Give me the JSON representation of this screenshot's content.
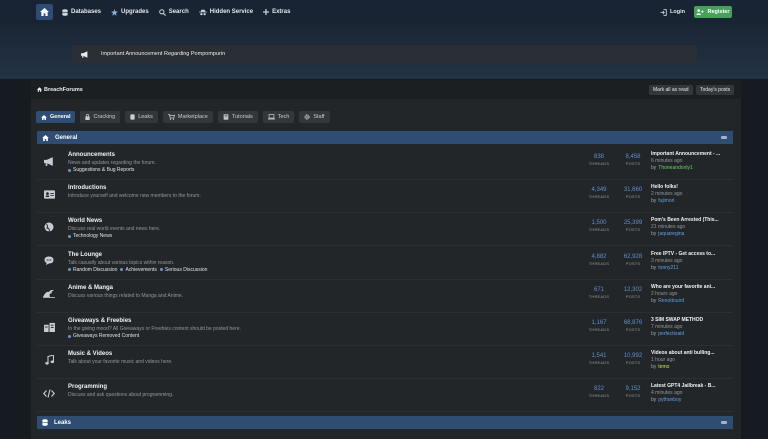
{
  "nav": {
    "items": [
      {
        "label": "Databases",
        "icon": "database-icon"
      },
      {
        "label": "Upgrades",
        "icon": "star-icon"
      },
      {
        "label": "Search",
        "icon": "search-icon"
      },
      {
        "label": "Hidden Service",
        "icon": "incognito-icon"
      },
      {
        "label": "Extras",
        "icon": "plus-icon"
      }
    ],
    "login_label": "Login",
    "register_label": "Register"
  },
  "announcement": {
    "text": "Important Announcement Regarding Pompompurin"
  },
  "breadcrumb": {
    "label": "BreachForums"
  },
  "header_buttons": {
    "mark_read": "Mark all as read",
    "todays_posts": "Today's posts"
  },
  "tabs": [
    {
      "label": "General",
      "icon": "home-icon",
      "active": true
    },
    {
      "label": "Cracking",
      "icon": "lock-icon"
    },
    {
      "label": "Leaks",
      "icon": "database-icon"
    },
    {
      "label": "Marketplace",
      "icon": "cart-icon"
    },
    {
      "label": "Tutorials",
      "icon": "book-icon"
    },
    {
      "label": "Tech",
      "icon": "laptop-icon"
    },
    {
      "label": "Staff",
      "icon": "gear-icon"
    }
  ],
  "categories": {
    "general": {
      "title": "General"
    },
    "leaks": {
      "title": "Leaks"
    }
  },
  "forums": [
    {
      "title": "Announcements",
      "description": "News and updates regarding the forum.",
      "subforums": [
        "Suggestions & Bug Reports"
      ],
      "threads": "838",
      "posts": "8,458",
      "last_title": "Important Announcement - ...",
      "last_time": "6 minutes ago",
      "last_user": "Thoneandonly1",
      "user_color": "#6fcf5f",
      "icon": "megaphone-icon"
    },
    {
      "title": "Introductions",
      "description": "Introduce yourself and welcome new members to the forum.",
      "subforums": [],
      "threads": "4,349",
      "posts": "31,660",
      "last_title": "Hello folks!",
      "last_time": "2 minutes ago",
      "last_user": "fujimori",
      "user_color": "#5fa0e6",
      "icon": "id-card-icon"
    },
    {
      "title": "World News",
      "description": "Discuss real world events and news here.",
      "subforums": [
        "Technology News"
      ],
      "threads": "1,500",
      "posts": "25,399",
      "last_title": "Pom's Been Arrested (This...",
      "last_time": "21 minutes ago",
      "last_user": "jaquaregina",
      "user_color": "#5fa0e6",
      "icon": "globe-icon"
    },
    {
      "title": "The Lounge",
      "description": "Talk casually about various topics within reason.",
      "subforums": [
        "Random Discussion",
        "Achievements",
        "Serious Discussion"
      ],
      "threads": "4,882",
      "posts": "62,928",
      "last_title": "Free IPTV - Get access to...",
      "last_time": "3 minutes ago",
      "last_user": "tonny211",
      "user_color": "#5fa0e6",
      "icon": "chat-icon"
    },
    {
      "title": "Anime & Manga",
      "description": "Discuss various things related to Manga and Anime.",
      "subforums": [],
      "threads": "671",
      "posts": "12,302",
      "last_title": "Who are your favorite ani...",
      "last_time": "2 hours ago",
      "last_user": "Renottound",
      "user_color": "#5fa0e6",
      "icon": "wave-icon"
    },
    {
      "title": "Giveaways & Freebies",
      "description": "In the giving mood? All Giveaways or Freebies content should be posted here.",
      "subforums": [
        "Giveaways Removed Content"
      ],
      "threads": "1,167",
      "posts": "68,876",
      "last_title": "3 SIM SWAP METHOD",
      "last_time": "7 minutes ago",
      "last_user": "perfectioaid",
      "user_color": "#5fa0e6",
      "icon": "gift-icon"
    },
    {
      "title": "Music & Videos",
      "description": "Talk about your favorite music and videos here.",
      "subforums": [],
      "threads": "1,541",
      "posts": "10,992",
      "last_title": "Videos about anti bulling...",
      "last_time": "1 hour ago",
      "last_user": "temo",
      "user_color": "#dede52",
      "icon": "music-icon"
    },
    {
      "title": "Programming",
      "description": "Discuss and ask questions about programming.",
      "subforums": [],
      "threads": "822",
      "posts": "9,152",
      "last_title": "Latest GPT4 Jailbreak - B...",
      "last_time": "4 minutes ago",
      "last_user": "pythonboy",
      "user_color": "#5fa0e6",
      "icon": "code-icon"
    }
  ],
  "labels": {
    "threads": "THREADS",
    "posts": "POSTS",
    "by": "by"
  }
}
